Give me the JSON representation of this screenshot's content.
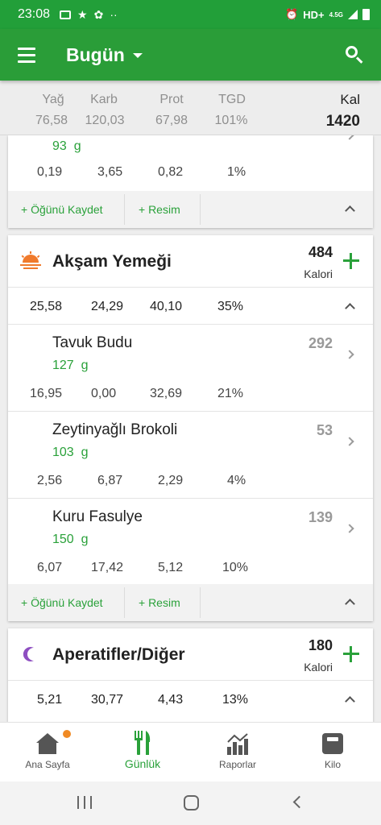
{
  "status_bar": {
    "time": "23:08",
    "network": "HD+",
    "net_gen": "4.5G"
  },
  "app_bar": {
    "title": "Bugün"
  },
  "totals": {
    "labels": [
      "Yağ",
      "Karb",
      "Prot",
      "TGD"
    ],
    "values": [
      "76,58",
      "120,03",
      "67,98",
      "101%"
    ],
    "kal_label": "Kal",
    "kal_value": "1420"
  },
  "partial_item": {
    "qty": "93",
    "unit": "g",
    "macros": [
      "0,19",
      "3,65",
      "0,82",
      "1%"
    ]
  },
  "meal_actions": {
    "save_label": "+ Öğünü Kaydet",
    "photo_label": "+ Resim"
  },
  "dinner": {
    "title": "Akşam Yemeği",
    "calories": "484",
    "calories_label": "Kalori",
    "macros": [
      "25,58",
      "24,29",
      "40,10",
      "35%"
    ],
    "items": [
      {
        "name": "Tavuk Budu",
        "qty": "127",
        "unit": "g",
        "cal": "292",
        "macros": [
          "16,95",
          "0,00",
          "32,69",
          "21%"
        ]
      },
      {
        "name": "Zeytinyağlı Brokoli",
        "qty": "103",
        "unit": "g",
        "cal": "53",
        "macros": [
          "2,56",
          "6,87",
          "2,29",
          "4%"
        ]
      },
      {
        "name": "Kuru Fasulye",
        "qty": "150",
        "unit": "g",
        "cal": "139",
        "macros": [
          "6,07",
          "17,42",
          "5,12",
          "10%"
        ]
      }
    ]
  },
  "snacks": {
    "title": "Aperatifler/Diğer",
    "calories": "180",
    "calories_label": "Kalori",
    "macros": [
      "5,21",
      "30,77",
      "4,43",
      "13%"
    ]
  },
  "bottom_nav": {
    "items": [
      {
        "label": "Ana Sayfa",
        "icon": "home-icon"
      },
      {
        "label": "Günlük",
        "icon": "fork-knife-icon"
      },
      {
        "label": "Raporlar",
        "icon": "chart-icon"
      },
      {
        "label": "Kilo",
        "icon": "scale-icon"
      }
    ]
  },
  "colors": {
    "brand_green": "#2a9d38",
    "accent_text": "#2aa13a",
    "badge": "#f08a24",
    "moon": "#8e4fc1",
    "sunset": "#f07a2c"
  }
}
